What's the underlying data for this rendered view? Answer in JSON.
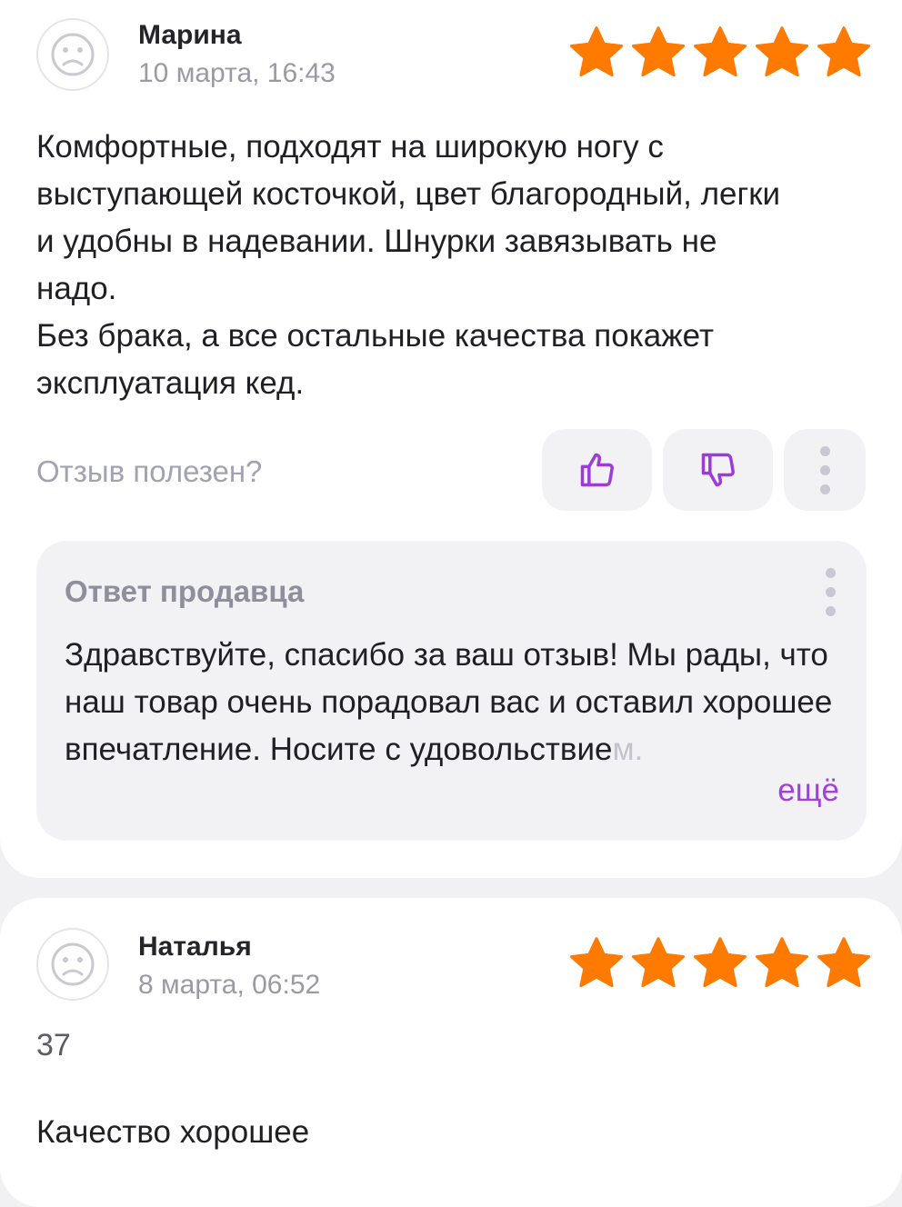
{
  "colors": {
    "star": "#ff7a00",
    "accent": "#a43ee0",
    "muted": "#9a9aa6"
  },
  "reviews": [
    {
      "author": "Марина",
      "date": "10 марта, 16:43",
      "rating": 5,
      "text": "Комфортные, подходят на широкую ногу с\nвыступающей косточкой, цвет благородный, легки\nи удобны в надевании. Шнурки завязывать не\nнадо.\nБез брака, а все остальные качества покажет\nэксплуатация кед.",
      "helpful_label": "Отзыв полезен?",
      "like_icon": "thumbs-up-icon",
      "dislike_icon": "thumbs-down-icon",
      "more_icon": "vertical-dots-icon",
      "seller_reply": {
        "title": "Ответ продавца",
        "text": "Здравствуйте, спасибо за ваш отзыв! Мы рады, что наш товар очень порадовал вас и оставил хорошее впечатление. Носите с удовольствие",
        "text_faded": "м.",
        "more_label": "ещё"
      }
    },
    {
      "author": "Наталья",
      "date": "8 марта, 06:52",
      "rating": 5,
      "size": "37",
      "text": "Качество хорошее"
    }
  ]
}
